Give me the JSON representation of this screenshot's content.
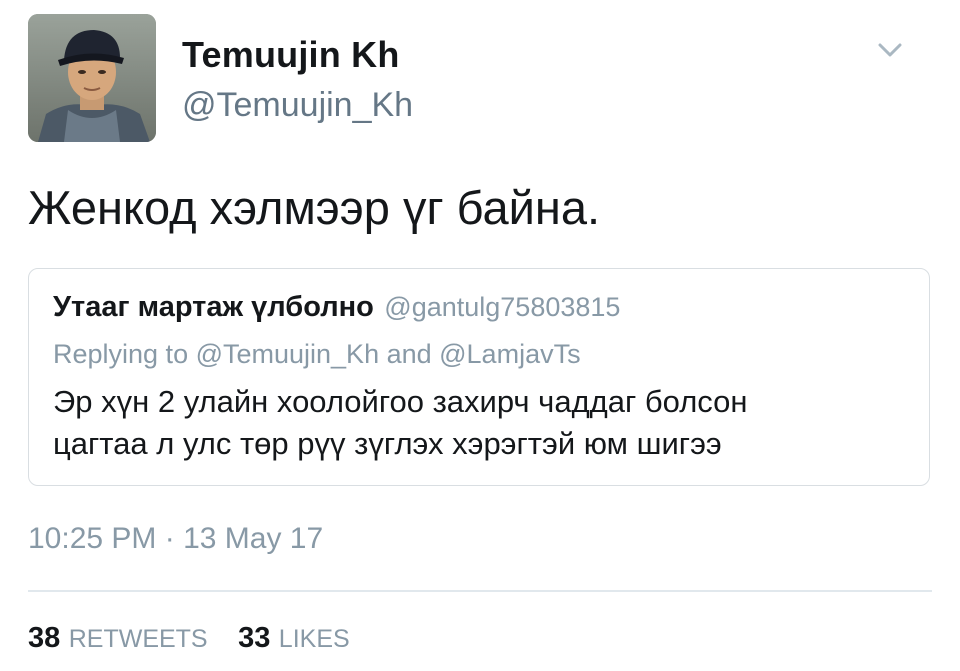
{
  "tweet": {
    "author": {
      "display_name": "Temuujin Kh",
      "handle": "@Temuujin_Kh"
    },
    "menu_icon": "chevron-down-icon",
    "text": "Женкод хэлмээр үг байна.",
    "quoted": {
      "display_name": "Утааг мартаж үлболно",
      "handle": "@gantulg75803815",
      "replying_to": "Replying to @Temuujin_Kh and @LamjavTs",
      "body_lines": [
        "Эр хүн 2 улайн хоолойгоо захирч чаддаг болсон",
        "цагтаа л улс төр рүү зүглэх хэрэгтэй юм шигээ"
      ]
    },
    "timestamp": "10:25 PM · 13 May 17",
    "stats": {
      "retweets_count": "38",
      "retweets_label": "RETWEETS",
      "likes_count": "33",
      "likes_label": "LIKES"
    }
  },
  "colors": {
    "primary_text": "#14171a",
    "secondary_text": "#8899a6",
    "handle_text": "#657786",
    "border": "#d9dee2",
    "chevron": "#aab8c2"
  }
}
